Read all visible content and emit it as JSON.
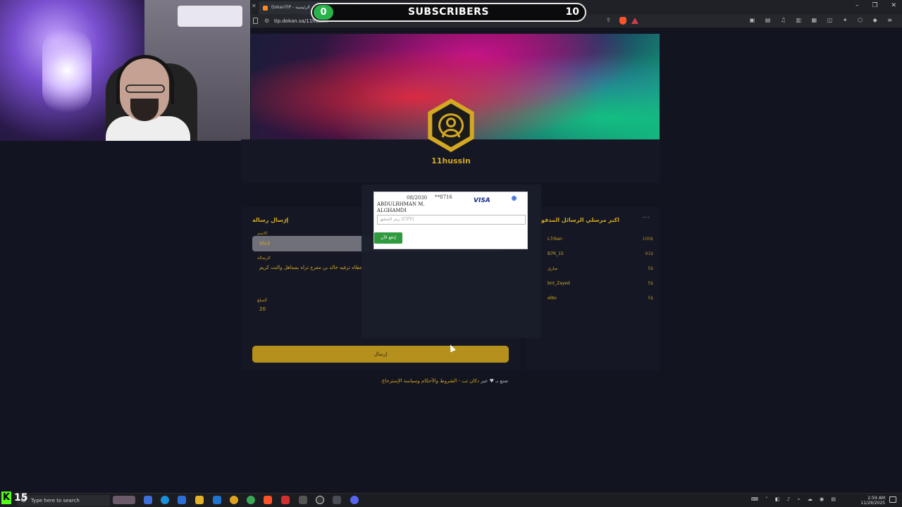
{
  "overlay": {
    "subscriber_count": "0",
    "subscriber_label": "SUBSCRIBERS",
    "subscriber_goal": "10",
    "kick_viewers": "15"
  },
  "browser": {
    "tab_title": "DokanTIP - الرئيسية",
    "url": "tip.dokan.sa/11hussin"
  },
  "profile": {
    "username": "11hussin"
  },
  "send_form": {
    "title": "إرسال رسالة",
    "name_label": "الاسم",
    "name_value": "9lo3",
    "message_label": "الرسالة",
    "message_value": "م وعطاه ترفيه خالد بن مفرح تراه يستاهل والنت كريم",
    "amount_label": "المبلغ",
    "amount_value": "20",
    "submit_label": "إرسال"
  },
  "top_senders": {
    "title": "اكبر مرسلي الرسائل المدفو",
    "rows": [
      {
        "name": "L7rban",
        "amount": "100$"
      },
      {
        "name": "B7R_15",
        "amount": "91$"
      },
      {
        "name": "ساري",
        "amount": "5$"
      },
      {
        "name": "bnt_Zayed",
        "amount": "5$"
      },
      {
        "name": "elbo",
        "amount": "5$"
      }
    ]
  },
  "payment": {
    "card_holder": "ABDULRHMAN M. ALGHAMDI",
    "expiry": "08/2030",
    "last4": "**8716",
    "brand": "VISA",
    "cvv_placeholder": "رمز التحقق (CVV)",
    "pay_button": "إدفع الآن"
  },
  "footer": {
    "prefix": "صنع بـ",
    "by": "عبر",
    "brand": "دكان تب",
    "sep": " - ",
    "links": "الشروط والأحكام وسياسة الإسترجاع"
  },
  "taskbar": {
    "search_placeholder": "Type here to search",
    "time": "2:59 AM",
    "date": "11/29/2025"
  }
}
